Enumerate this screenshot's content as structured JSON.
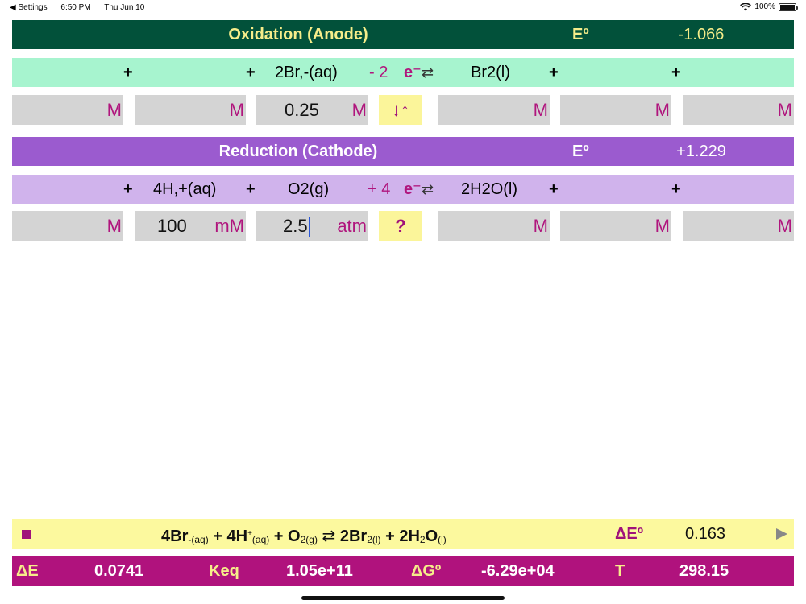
{
  "status_bar": {
    "back_app": "◀ Settings",
    "time": "6:50 PM",
    "date": "Thu Jun 10",
    "battery": "100%",
    "battery_level": 1.0
  },
  "oxidation": {
    "title": "Oxidation (Anode)",
    "e_label": "Eº",
    "e_value": "-1.066",
    "equation": {
      "plus1": "+",
      "plus2": "+",
      "reactant": "2Br,-(aq)",
      "electrons": "- 2",
      "e_symbol": "e⁻",
      "arrow": "⇄",
      "product": "Br2(l)",
      "plus3": "+",
      "plus4": "+"
    },
    "conc": {
      "c1_unit": "M",
      "c2_unit": "M",
      "c3_value": "0.25",
      "c3_unit": "M",
      "direction_button": "↓↑",
      "c4_unit": "M",
      "c5_unit": "M",
      "c6_unit": "M"
    }
  },
  "reduction": {
    "title": "Reduction (Cathode)",
    "e_label": "Eº",
    "e_value": "+1.229",
    "equation": {
      "plus1": "+",
      "reactant1": "4H,+(aq)",
      "plus2": "+",
      "reactant2": "O2(g)",
      "electrons": "+ 4",
      "e_symbol": "e⁻",
      "arrow": "⇄",
      "product": "2H2O(l)",
      "plus3": "+",
      "plus4": "+"
    },
    "conc": {
      "c1_unit": "M",
      "c2_value": "100",
      "c2_unit": "mM",
      "c3_value": "2.5",
      "c3_unit": "atm",
      "help_button": "?",
      "c4_unit": "M",
      "c5_unit": "M",
      "c6_unit": "M"
    }
  },
  "overall": {
    "eq_part1": "4Br",
    "eq_sub1": "-(aq)",
    "eq_part2": " + 4H",
    "eq_sup2": "+",
    "eq_sub2": "(aq)",
    "eq_part3": " + O",
    "eq_sub3": "2(g)",
    "eq_arrow": " ⇄ ",
    "eq_part4": "2Br",
    "eq_sub4": "2(l)",
    "eq_part5": " + 2H",
    "eq_sub5": "2",
    "eq_part6": "O",
    "eq_sub6": "(l)",
    "delta_e0_label": "ΔEº",
    "delta_e0_value": "0.163"
  },
  "results": {
    "delta_e_label": "ΔE",
    "delta_e_value": "0.0741",
    "keq_label": "Keq",
    "keq_value": "1.05e+11",
    "delta_g_label": "ΔGº",
    "delta_g_value": "-6.29e+04",
    "t_label": "T",
    "t_value": "298.15"
  },
  "colors": {
    "oxidation_header": "#02513a",
    "oxidation_row": "#a7f4cf",
    "reduction_header": "#9b5bcf",
    "reduction_row": "#d0b3ec",
    "accent_magenta": "#b0127d",
    "button_yellow": "#fbf59a"
  }
}
